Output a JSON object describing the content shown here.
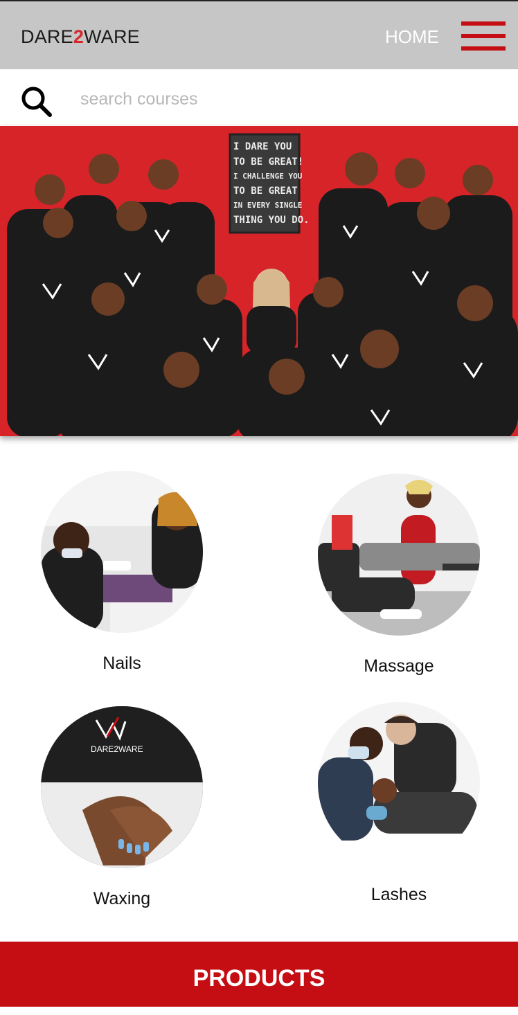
{
  "header": {
    "brand_prefix": "DARE",
    "brand_number": "2",
    "brand_suffix": "WARE",
    "home_label": "HOME",
    "menu_icon": "hamburger-icon",
    "accent_color": "#c40e14"
  },
  "search": {
    "placeholder": "search courses",
    "value": ""
  },
  "hero": {
    "poster_lines": [
      "I DARE YOU",
      "TO BE GREAT!",
      "I CHALLENGE YOU",
      "TO BE GREAT",
      "IN EVERY SINGLE",
      "THING YOU DO."
    ]
  },
  "courses": [
    {
      "label": "Nails"
    },
    {
      "label": "Massage"
    },
    {
      "label": "Waxing"
    },
    {
      "label": "Lashes"
    }
  ],
  "footer": {
    "products_label": "PRODUCTS"
  }
}
